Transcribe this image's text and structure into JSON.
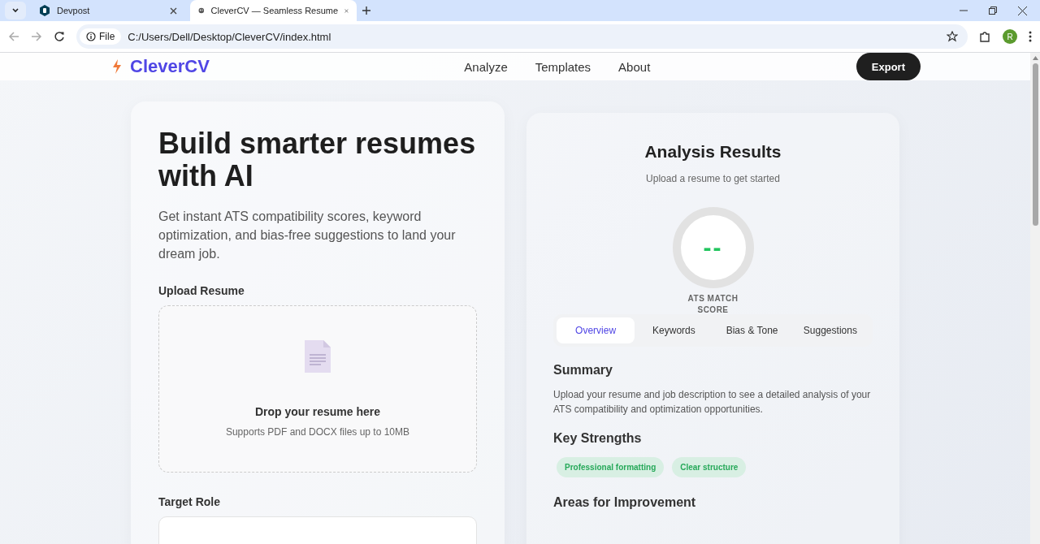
{
  "browser": {
    "tabs": [
      {
        "title": "Devpost",
        "selected": false
      },
      {
        "title": "CleverCV — Seamless Resume",
        "selected": true
      }
    ],
    "address": {
      "scheme": "File",
      "url": "C:/Users/Dell/Desktop/CleverCV/index.html"
    },
    "profile": "R"
  },
  "nav": {
    "logo": "CleverCV",
    "links": [
      "Analyze",
      "Templates",
      "About"
    ],
    "action": "Export"
  },
  "builder": {
    "title": "Build smarter resumes with AI",
    "subtitle": "Get instant ATS compatibility scores, keyword optimization, and bias-free suggestions to land your dream job.",
    "upload_label": "Upload Resume",
    "drop_title": "Drop your resume here",
    "drop_hint": "Supports PDF and DOCX files up to 10MB",
    "role_label": "Target Role"
  },
  "results": {
    "title": "Analysis Results",
    "subtitle": "Upload a resume to get started",
    "score": "--",
    "score_label": "ATS MATCH SCORE",
    "tabs": [
      {
        "label": "Overview",
        "selected": true
      },
      {
        "label": "Keywords",
        "selected": false
      },
      {
        "label": "Bias & Tone",
        "selected": false
      },
      {
        "label": "Suggestions",
        "selected": false
      }
    ],
    "summary_heading": "Summary",
    "summary": "Upload your resume and job description to see a detailed analysis of your ATS compatibility and optimization opportunities.",
    "strengths_heading": "Key Strengths",
    "strengths": [
      "Professional formatting",
      "Clear structure"
    ],
    "improvement_heading": "Areas for Improvement"
  }
}
